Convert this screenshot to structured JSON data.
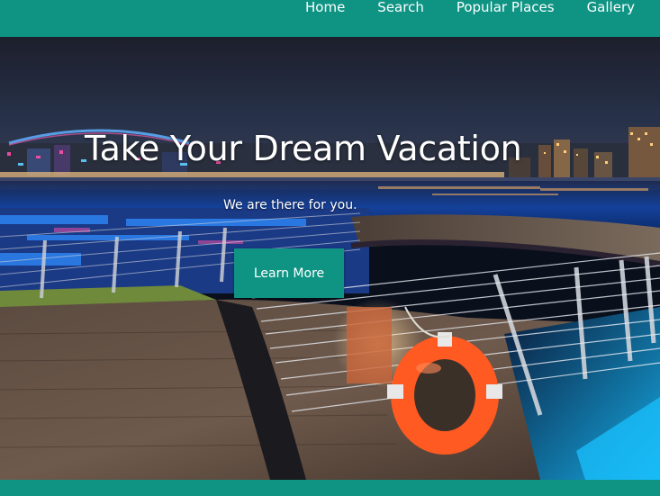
{
  "nav": {
    "items": [
      {
        "label": "Home"
      },
      {
        "label": "Search"
      },
      {
        "label": "Popular Places"
      },
      {
        "label": "Gallery"
      }
    ]
  },
  "hero": {
    "title": "Take Your Dream Vacation",
    "subtitle": "We are there for you.",
    "button_label": "Learn More",
    "background_image": "night-bridge-photo"
  },
  "colors": {
    "accent": "#0f9484",
    "text": "#ffffff"
  }
}
